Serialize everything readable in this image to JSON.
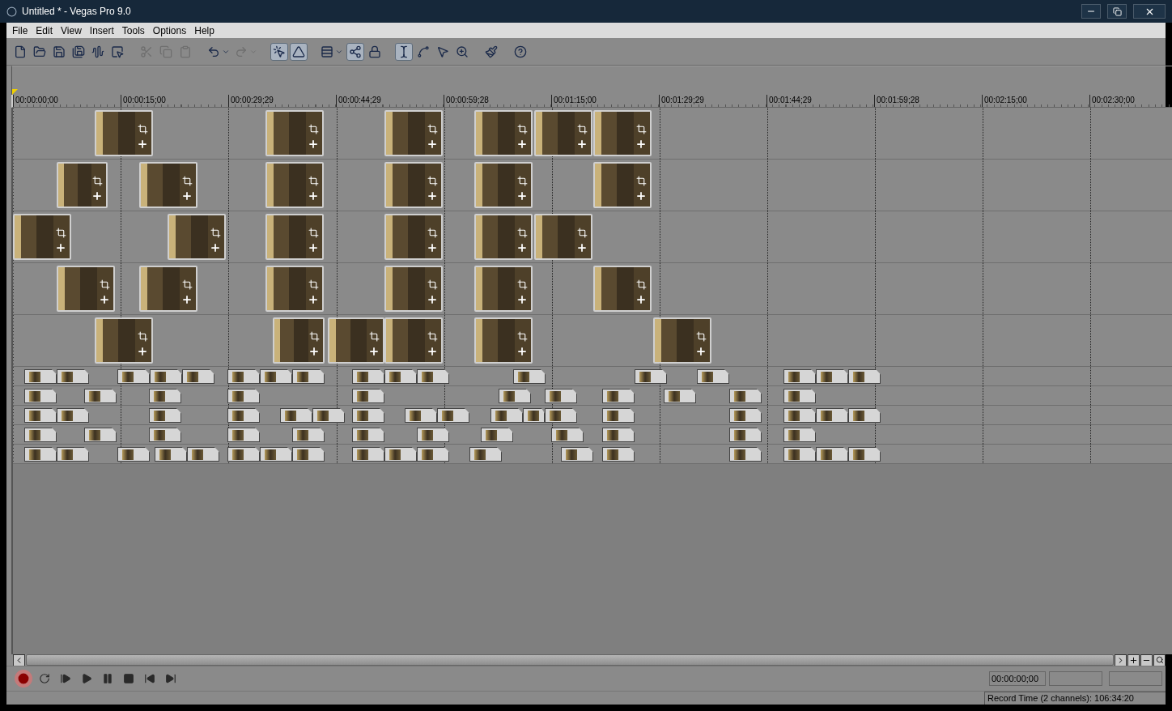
{
  "window": {
    "title": "Untitled * - Vegas Pro 9.0"
  },
  "menu": [
    "File",
    "Edit",
    "View",
    "Insert",
    "Tools",
    "Options",
    "Help"
  ],
  "toolbar": [
    {
      "kind": "button",
      "pressed": false,
      "disabled": false
    },
    {
      "kind": "button",
      "pressed": false,
      "disabled": false
    },
    {
      "kind": "button",
      "pressed": false,
      "disabled": false
    },
    {
      "kind": "button",
      "pressed": false,
      "disabled": false
    },
    {
      "kind": "button",
      "pressed": false,
      "disabled": false
    },
    {
      "kind": "button",
      "pressed": false,
      "disabled": false
    },
    {
      "kind": "separator"
    },
    {
      "kind": "button",
      "pressed": false,
      "disabled": true
    },
    {
      "kind": "button",
      "pressed": false,
      "disabled": true
    },
    {
      "kind": "button",
      "pressed": false,
      "disabled": true
    },
    {
      "kind": "separator"
    },
    {
      "kind": "dropdown",
      "pressed": false,
      "disabled": false
    },
    {
      "kind": "dropdown",
      "pressed": false,
      "disabled": true
    },
    {
      "kind": "separator"
    },
    {
      "kind": "button",
      "pressed": true,
      "disabled": false
    },
    {
      "kind": "button",
      "pressed": true,
      "disabled": false
    },
    {
      "kind": "separator"
    },
    {
      "kind": "dropdown",
      "pressed": false,
      "disabled": false
    },
    {
      "kind": "button",
      "pressed": true,
      "disabled": false
    },
    {
      "kind": "button",
      "pressed": false,
      "disabled": false
    },
    {
      "kind": "separator"
    },
    {
      "kind": "button",
      "pressed": true,
      "disabled": false
    },
    {
      "kind": "button",
      "pressed": false,
      "disabled": false
    },
    {
      "kind": "button",
      "pressed": false,
      "disabled": false
    },
    {
      "kind": "button",
      "pressed": false,
      "disabled": false
    },
    {
      "kind": "separator"
    },
    {
      "kind": "button",
      "pressed": false,
      "disabled": false
    },
    {
      "kind": "separator"
    },
    {
      "kind": "button",
      "pressed": false,
      "disabled": false
    }
  ],
  "ruler": [
    "00:00:00;00",
    "00:00:15;00",
    "00:00:29;29",
    "00:00:44;29",
    "00:00:59;28",
    "00:01:15;00",
    "00:01:29;29",
    "00:01:44;29",
    "00:01:59;28",
    "00:02:15;00",
    "00:02:30;00"
  ],
  "tracks": [
    {
      "kind": "video"
    },
    {
      "kind": "video"
    },
    {
      "kind": "video"
    },
    {
      "kind": "video"
    },
    {
      "kind": "video"
    },
    {
      "kind": "audio"
    },
    {
      "kind": "audio"
    },
    {
      "kind": "audio"
    },
    {
      "kind": "audio"
    },
    {
      "kind": "audio"
    }
  ],
  "transport": [
    {
      "kind": "record",
      "selected": true
    },
    {
      "kind": "loop",
      "selected": false
    },
    {
      "kind": "play-start",
      "selected": false
    },
    {
      "kind": "play",
      "selected": false
    },
    {
      "kind": "pause",
      "selected": false
    },
    {
      "kind": "stop",
      "selected": false
    },
    {
      "kind": "prev",
      "selected": false
    },
    {
      "kind": "next",
      "selected": false
    }
  ],
  "time_display": "00:00:00;00",
  "status_bar": "Record Time (2 channels): 106:34:20"
}
